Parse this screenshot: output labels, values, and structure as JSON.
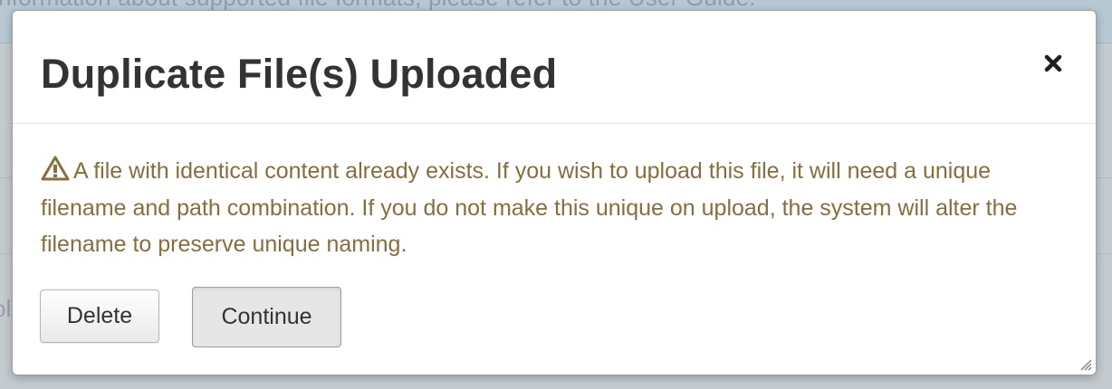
{
  "backdrop": {
    "banner_text": "nformation about supported file formats, please refer to the User Guide.",
    "fragment_text": "ol"
  },
  "modal": {
    "title": "Duplicate File(s) Uploaded",
    "close_icon": "close-icon",
    "warning_icon": "warning-triangle-icon",
    "message": "A file with identical content already exists. If you wish to upload this file, it will need a unique filename and path combination. If you do not make this unique on upload, the system will alter the filename to preserve unique naming.",
    "buttons": {
      "delete_label": "Delete",
      "continue_label": "Continue"
    }
  },
  "colors": {
    "warning_text": "#8a6d3b",
    "title": "#333333"
  }
}
